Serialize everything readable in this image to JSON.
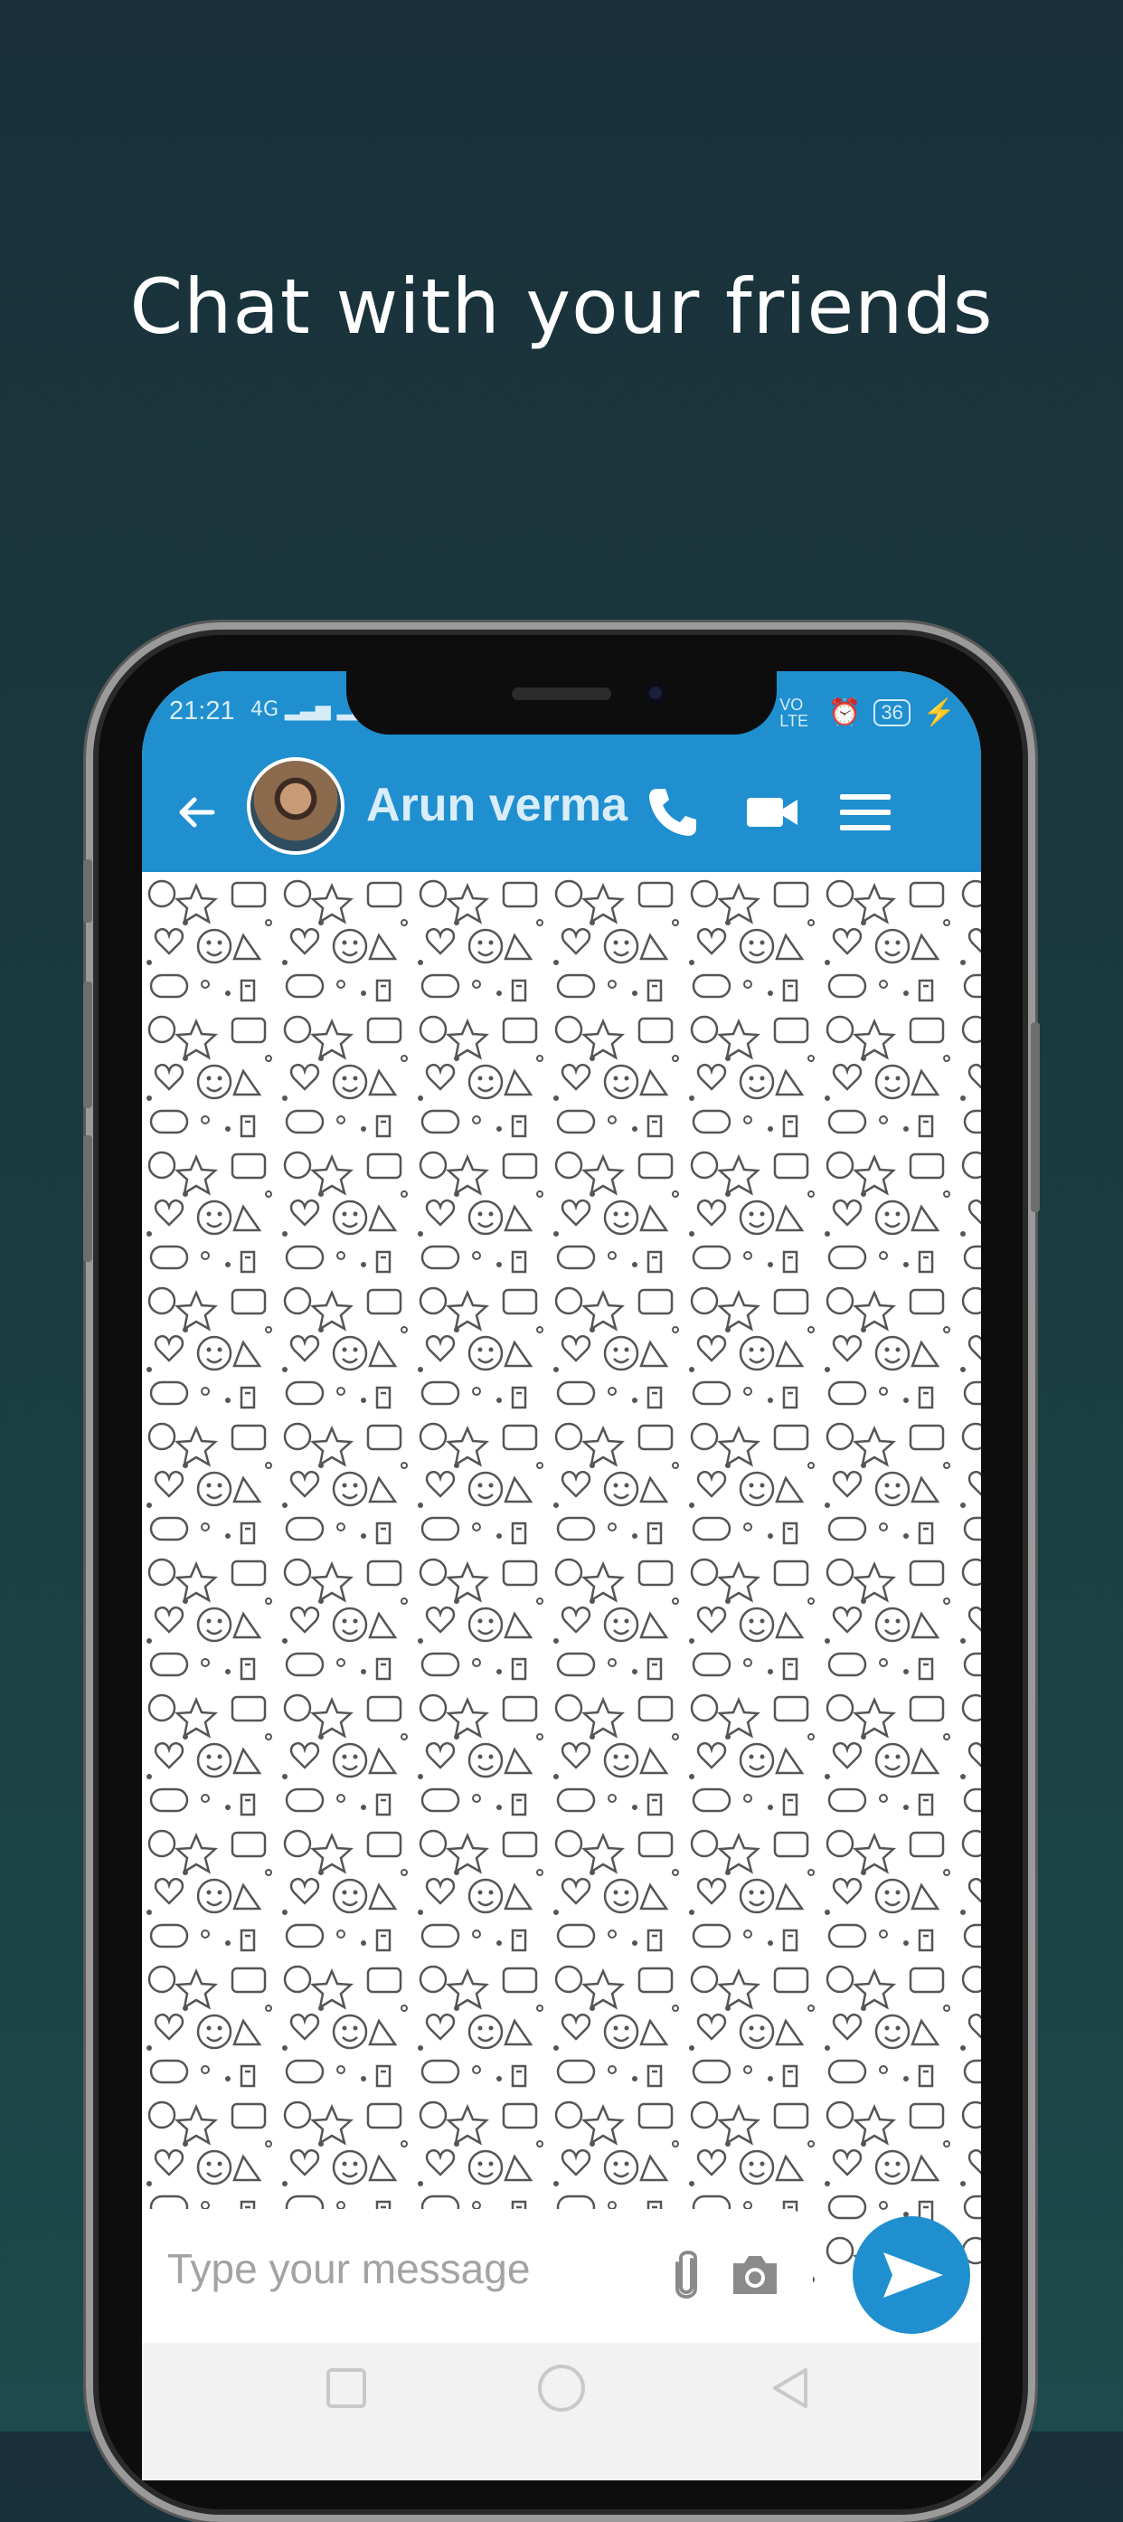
{
  "headline": "Chat with your friends",
  "status_bar": {
    "time": "21:21",
    "network": "4G",
    "volte": "VO LTE",
    "battery": "36"
  },
  "chat_header": {
    "contact_name": "Arun verma",
    "icons": [
      "back-arrow-icon",
      "avatar",
      "phone-icon",
      "video-camera-icon",
      "menu-icon"
    ]
  },
  "composer": {
    "placeholder": "Type your message",
    "icons": [
      "attachment-icon",
      "camera-icon",
      "send-icon"
    ]
  },
  "colors": {
    "background": "#19303a",
    "app_bar": "#1f8fcf",
    "send_button": "#1f8fcf"
  }
}
